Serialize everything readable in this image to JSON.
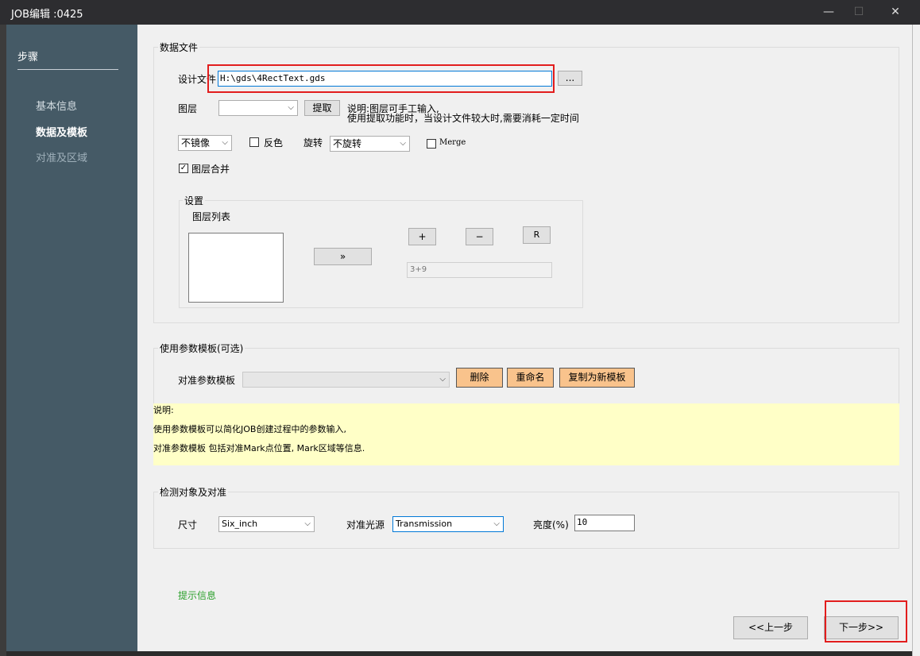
{
  "window": {
    "title": "JOB编辑 :0425",
    "minimize": "—",
    "maximize": "☐",
    "close": "✕"
  },
  "sidebar": {
    "header": "步骤",
    "items": [
      {
        "label": "基本信息",
        "state": "done"
      },
      {
        "label": "数据及模板",
        "state": "active"
      },
      {
        "label": "对准及区域",
        "state": "pending"
      }
    ]
  },
  "data_file": {
    "group_label": "数据文件",
    "design_file_label": "设计文件",
    "design_file_value": "H:\\gds\\4RectText.gds",
    "browse_label": "...",
    "layer_label": "图层",
    "layer_value": "",
    "extract_label": "提取",
    "hint_line1": "说明:图层可手工输入,",
    "hint_line2": "使用提取功能时，当设计文件较大时,需要消耗一定时间",
    "mirror_value": "不镜像",
    "invert_label": "反色",
    "invert_checked": false,
    "rotate_label": "旋转",
    "rotate_value": "不旋转",
    "merge_label": "Merge",
    "merge_checked": false,
    "layer_merge_label": "图层合并",
    "layer_merge_checked": true,
    "check_mark": "✓",
    "settings": {
      "group_label": "设置",
      "layer_list_label": "图层列表",
      "move_label": "»",
      "plus_label": "+",
      "minus_label": "−",
      "r_label": "R",
      "expression_value": "3+9"
    }
  },
  "template": {
    "group_label": "使用参数模板(可选)",
    "align_template_label": "对准参数模板",
    "align_template_value": "",
    "delete_label": "删除",
    "rename_label": "重命名",
    "copy_label": "复制为新模板",
    "notes": [
      "说明:",
      "使用参数模板可以简化JOB创建过程中的参数输入,",
      "对准参数模板  包括对准Mark点位置, Mark区域等信息."
    ]
  },
  "detect": {
    "group_label": "检测对象及对准",
    "size_label": "尺寸",
    "size_value": "Six_inch",
    "light_label": "对准光源",
    "light_value": "Transmission",
    "brightness_label": "亮度(%)",
    "brightness_value": "10"
  },
  "footer": {
    "hint_text": "提示信息",
    "prev_label": "<<上一步",
    "next_label": "下一步>>"
  },
  "colors": {
    "sidebar_bg": "#455a66",
    "highlight_red": "#e21d1d",
    "note_bg": "#ffffc7",
    "orange_button": "#f9c38c",
    "hint_green": "#2ca02c"
  }
}
